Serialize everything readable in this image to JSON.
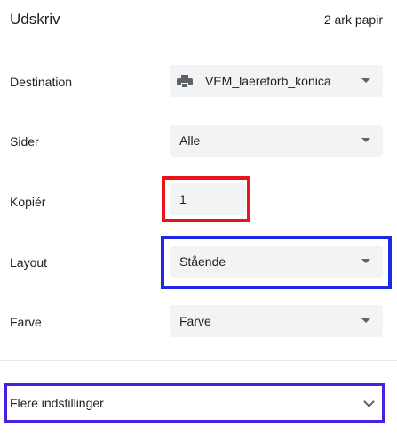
{
  "header": {
    "title": "Udskriv",
    "sheets": "2 ark papir"
  },
  "destination": {
    "label": "Destination",
    "value": "VEM_laereforb_konica",
    "icon": "printer-icon"
  },
  "pages": {
    "label": "Sider",
    "value": "Alle"
  },
  "copies": {
    "label": "Kopiér",
    "value": "1"
  },
  "layout": {
    "label": "Layout",
    "value": "Stående"
  },
  "color": {
    "label": "Farve",
    "value": "Farve"
  },
  "more_settings": {
    "label": "Flere indstillinger"
  },
  "colors": {
    "field_bg": "#f1f3f4",
    "red_highlight": "#e8141a",
    "blue_highlight": "#1b29e6",
    "purple_highlight": "#4b1fe0"
  }
}
